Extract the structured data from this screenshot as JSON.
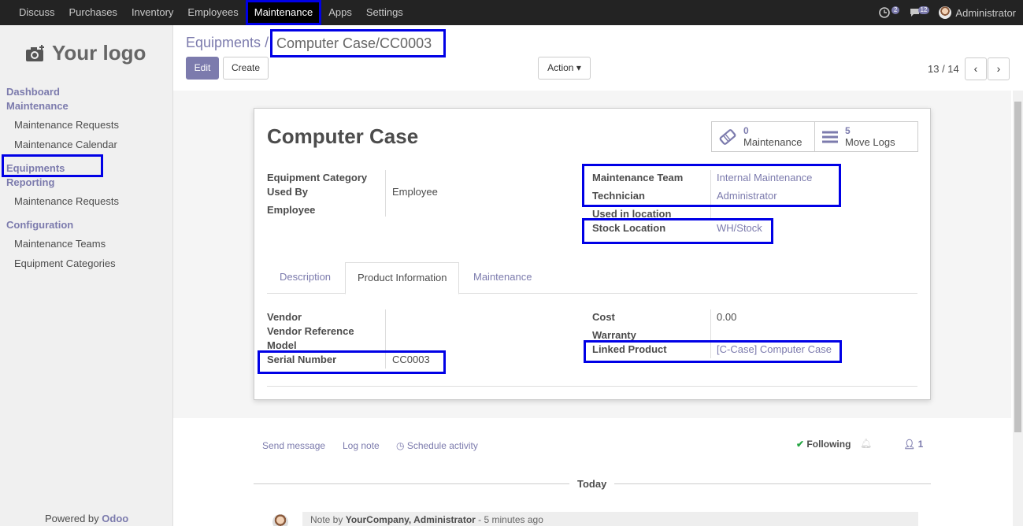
{
  "topbar": {
    "menu": [
      "Discuss",
      "Purchases",
      "Inventory",
      "Employees",
      "Maintenance",
      "Apps",
      "Settings"
    ],
    "active": "Maintenance",
    "activity_count": "2",
    "message_count": "12",
    "user_name": "Administrator"
  },
  "sidebar": {
    "logo_text": "Your logo",
    "sections": {
      "dashboard": "Dashboard",
      "maintenance": "Maintenance",
      "maintenance_requests": "Maintenance Requests",
      "maintenance_calendar": "Maintenance Calendar",
      "equipments": "Equipments",
      "reporting": "Reporting",
      "reporting_requests": "Maintenance Requests",
      "configuration": "Configuration",
      "maintenance_teams": "Maintenance Teams",
      "equipment_categories": "Equipment Categories"
    },
    "powered_prefix": "Powered by",
    "powered_brand": "Odoo"
  },
  "control": {
    "breadcrumb_parent": "Equipments",
    "breadcrumb_sep": "/",
    "breadcrumb_current": "Computer Case/CC0003",
    "edit_label": "Edit",
    "create_label": "Create",
    "action_label": "Action",
    "pager": "13 / 14"
  },
  "form": {
    "title": "Computer Case",
    "smart_maintenance_count": "0",
    "smart_maintenance_label": "Maintenance",
    "smart_moves_count": "5",
    "smart_moves_label": "Move Logs",
    "labels": {
      "equipment_category": "Equipment Category",
      "used_by": "Used By",
      "employee": "Employee",
      "maintenance_team": "Maintenance Team",
      "technician": "Technician",
      "used_in_location": "Used in location",
      "stock_location": "Stock Location"
    },
    "values": {
      "used_by": "Employee",
      "maintenance_team": "Internal Maintenance",
      "technician": "Administrator",
      "stock_location": "WH/Stock"
    },
    "tabs": [
      "Description",
      "Product Information",
      "Maintenance"
    ],
    "product_info": {
      "vendor_label": "Vendor",
      "vendor_ref_label": "Vendor Reference",
      "model_label": "Model",
      "serial_label": "Serial Number",
      "serial_value": "CC0003",
      "cost_label": "Cost",
      "cost_value": "0.00",
      "warranty_label": "Warranty",
      "linked_product_label": "Linked Product",
      "linked_product_value": "[C-Case] Computer Case"
    }
  },
  "chatter": {
    "send_message": "Send message",
    "log_note": "Log note",
    "schedule_activity": "Schedule activity",
    "following": "Following",
    "followers_count": "1",
    "today": "Today",
    "note_prefix": "Note by",
    "note_author": "YourCompany, Administrator",
    "note_time": "- 5 minutes ago"
  }
}
